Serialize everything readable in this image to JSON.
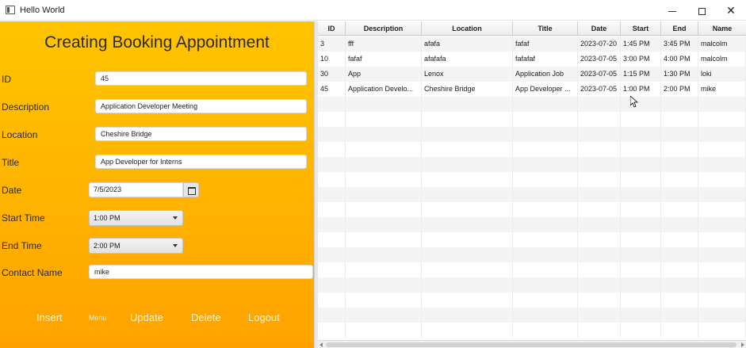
{
  "window": {
    "title": "Hello World",
    "minimize_icon": "minimize-icon",
    "maximize_icon": "maximize-icon",
    "close_icon": "close-icon",
    "close_glyph": "✕"
  },
  "form": {
    "title": "Creating Booking Appointment",
    "id_label": "ID",
    "id_value": "45",
    "description_label": "Description",
    "description_value": "Application Developer Meeting",
    "location_label": "Location",
    "location_value": "Cheshire Bridge",
    "title_label": "Title",
    "title_value": "App Developer for Interns",
    "date_label": "Date",
    "date_value": "7/5/2023",
    "start_label": "Start Time",
    "start_value": "1:00 PM",
    "end_label": "End Time",
    "end_value": "2:00 PM",
    "contact_label": "Contact Name",
    "contact_value": "mike"
  },
  "actions": {
    "insert": "Insert",
    "menu": "Menu",
    "update": "Update",
    "delete": "Delete",
    "logout": "Logout"
  },
  "table": {
    "columns": [
      "ID",
      "Description",
      "Location",
      "Title",
      "Date",
      "Start",
      "End",
      "Name"
    ],
    "rows": [
      [
        "3",
        "fff",
        "afafa",
        "fafaf",
        "2023-07-20",
        "1:45 PM",
        "3:45 PM",
        "malcolm"
      ],
      [
        "10",
        "fafaf",
        "afafafa",
        "fafafaf",
        "2023-07-05",
        "3:00 PM",
        "4:00 PM",
        "malcolm"
      ],
      [
        "30",
        "App",
        "Lenox",
        "Application Job",
        "2023-07-05",
        "1:15 PM",
        "1:30 PM",
        "loki"
      ],
      [
        "45",
        "Application Develo...",
        "Cheshire Bridge",
        "App Developer ...",
        "2023-07-05",
        "1:00 PM",
        "2:00 PM",
        "mike"
      ]
    ]
  },
  "colors": {
    "panel_top": "#ffc400",
    "panel_bottom": "#ffa200"
  }
}
